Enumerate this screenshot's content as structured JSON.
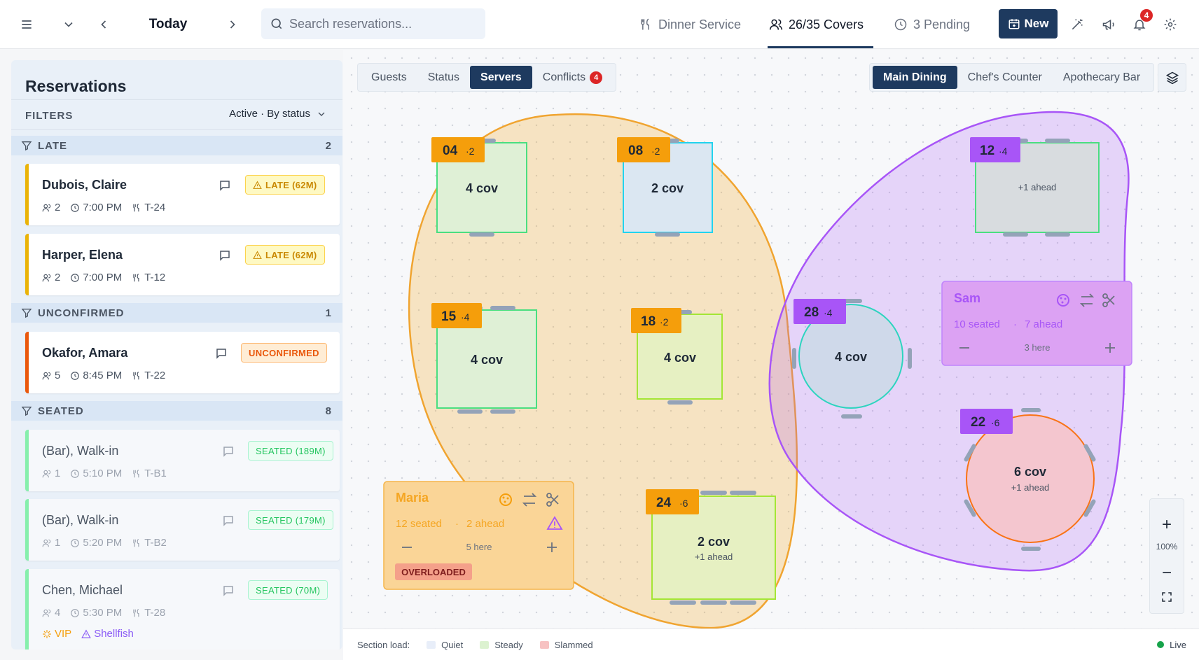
{
  "topbar": {
    "today_label": "Today",
    "search_placeholder": "Search reservations...",
    "service_label": "Dinner Service",
    "covers_label": "26/35 Covers",
    "pending_label": "3 Pending",
    "new_label": "New",
    "notification_count": "4"
  },
  "panel": {
    "title": "Reservations",
    "filters_label": "FILTERS",
    "filter_value": "Active · By status",
    "groups": [
      {
        "name": "LATE",
        "count": "2"
      },
      {
        "name": "UNCONFIRMED",
        "count": "1"
      },
      {
        "name": "SEATED",
        "count": "8"
      }
    ],
    "cards": [
      {
        "name": "Dubois, Claire",
        "party": "2",
        "time": "7:00 PM",
        "table": "T-24",
        "status": "LATE (62M)"
      },
      {
        "name": "Harper, Elena",
        "party": "2",
        "time": "7:00 PM",
        "table": "T-12",
        "status": "LATE (62M)"
      },
      {
        "name": "Okafor, Amara",
        "party": "5",
        "time": "8:45 PM",
        "table": "T-22",
        "status": "UNCONFIRMED"
      },
      {
        "name": "(Bar), Walk-in",
        "party": "1",
        "time": "5:10 PM",
        "table": "T-B1",
        "status": "SEATED (189M)"
      },
      {
        "name": "(Bar), Walk-in",
        "party": "1",
        "time": "5:20 PM",
        "table": "T-B2",
        "status": "SEATED (179M)"
      },
      {
        "name": "Chen, Michael",
        "party": "4",
        "time": "5:30 PM",
        "table": "T-28",
        "status": "SEATED (70M)",
        "tags": [
          "VIP",
          "Shellfish"
        ]
      }
    ]
  },
  "view_tabs": [
    {
      "label": "Guests"
    },
    {
      "label": "Status"
    },
    {
      "label": "Servers"
    },
    {
      "label": "Conflicts",
      "badge": "4"
    }
  ],
  "rooms": [
    {
      "label": "Main Dining"
    },
    {
      "label": "Chef's Counter"
    },
    {
      "label": "Apothecary Bar"
    }
  ],
  "tables": [
    {
      "id": "04",
      "seats": "·2",
      "covers": "4 cov",
      "note": ""
    },
    {
      "id": "08",
      "seats": "·2",
      "covers": "2 cov",
      "note": ""
    },
    {
      "id": "12",
      "seats": "·4",
      "covers": "",
      "note": "+1 ahead"
    },
    {
      "id": "15",
      "seats": "·4",
      "covers": "4 cov",
      "note": ""
    },
    {
      "id": "18",
      "seats": "·2",
      "covers": "4 cov",
      "note": ""
    },
    {
      "id": "28",
      "seats": "·4",
      "covers": "4 cov",
      "note": ""
    },
    {
      "id": "22",
      "seats": "·6",
      "covers": "6 cov",
      "note": "+1 ahead"
    },
    {
      "id": "24",
      "seats": "·6",
      "covers": "2 cov",
      "note": "+1 ahead"
    }
  ],
  "servers": {
    "maria": {
      "name": "Maria",
      "seated": "12 seated",
      "ahead": "2 ahead",
      "here": "5 here",
      "flag": "OVERLOADED"
    },
    "sam": {
      "name": "Sam",
      "seated": "10 seated",
      "ahead": "7 ahead",
      "here": "3 here"
    },
    "separator": "·"
  },
  "zoom": {
    "level": "100%"
  },
  "footer": {
    "label": "Section load:",
    "legend": [
      {
        "label": "Quiet",
        "color": "#e8eef9"
      },
      {
        "label": "Steady",
        "color": "#dcf2d0"
      },
      {
        "label": "Slammed",
        "color": "#f7c2c2"
      }
    ],
    "live": "Live"
  },
  "colors": {
    "brand": "#1e3a5f",
    "maria_section": "#f5a623",
    "sam_section": "#a855f7",
    "alert": "#dc2626"
  }
}
